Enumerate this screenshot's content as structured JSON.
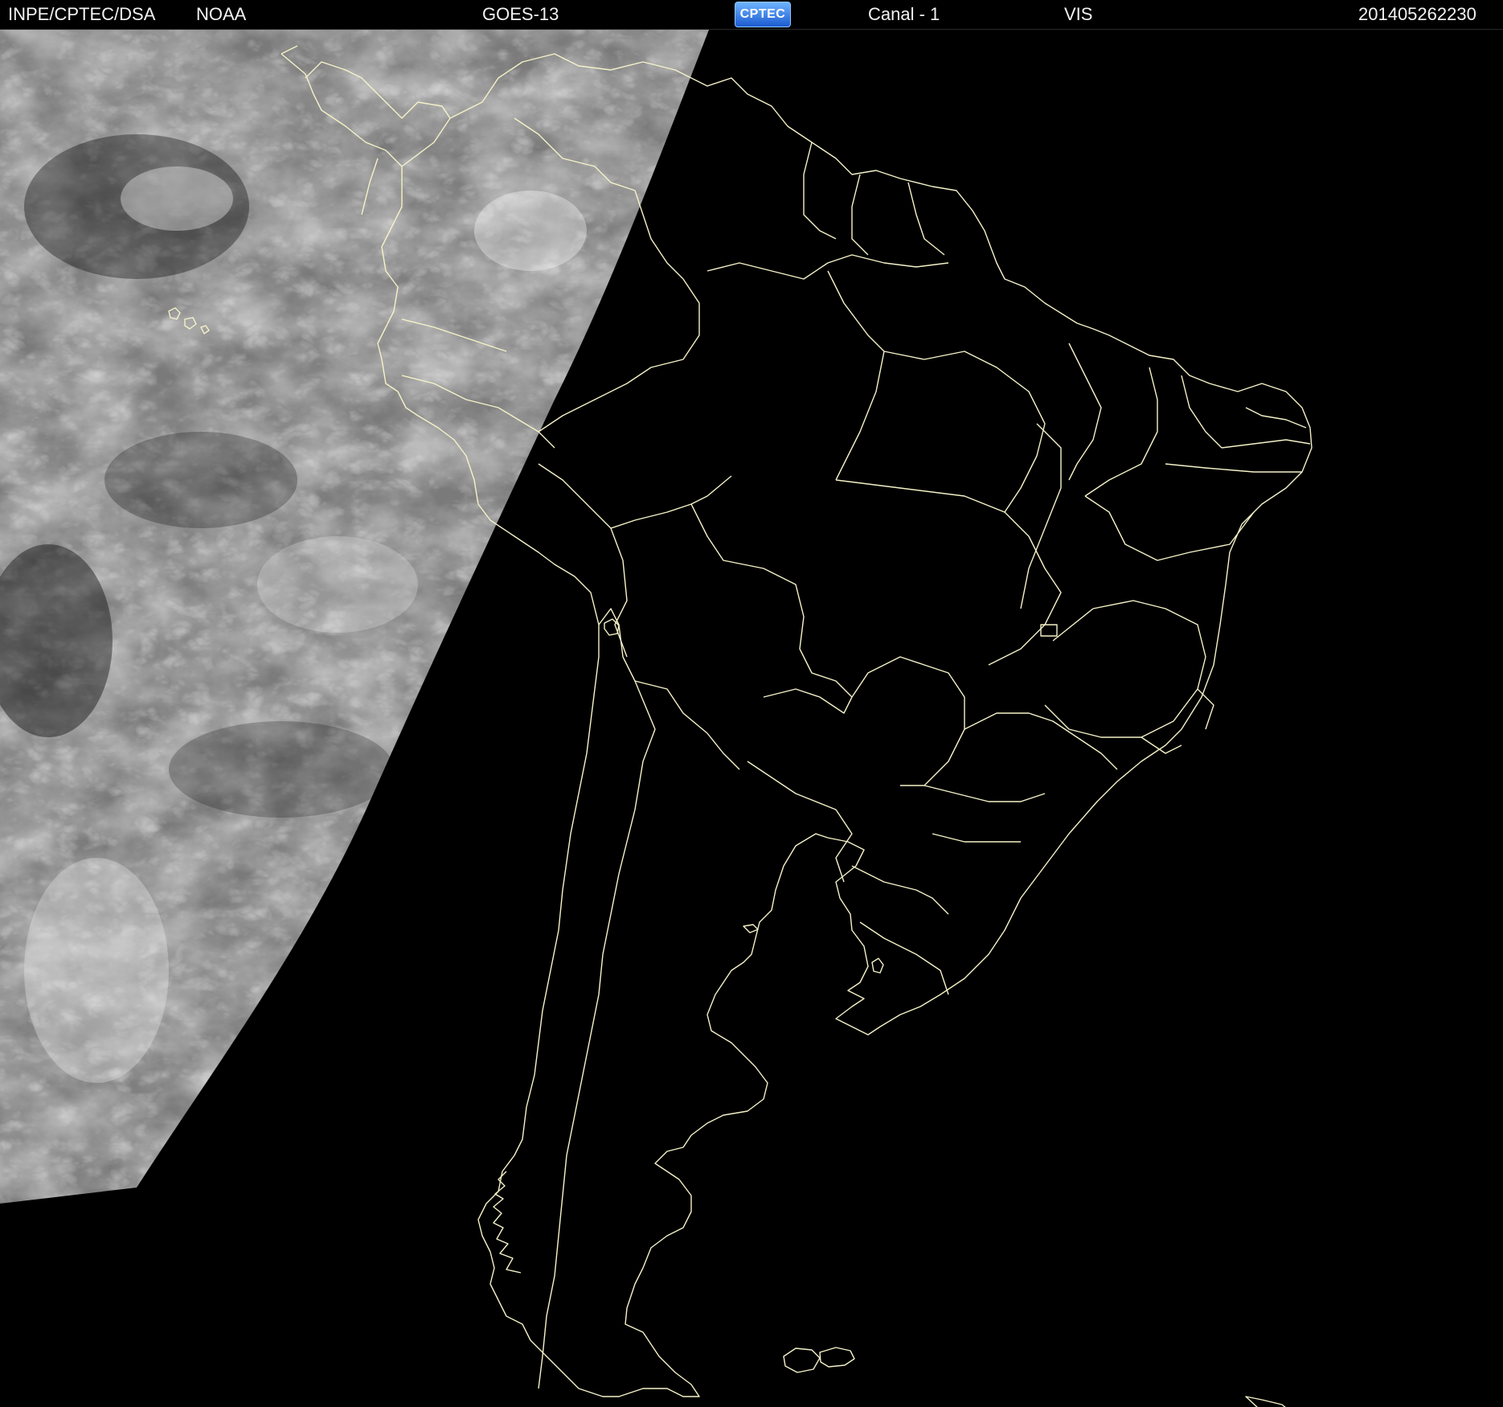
{
  "header": {
    "institute": "INPE/CPTEC/DSA",
    "agency": "NOAA",
    "satellite": "GOES-13",
    "logo_text": "CPTEC",
    "channel": "Canal - 1",
    "band": "VIS",
    "timestamp": "201405262230"
  },
  "map": {
    "region": "South America",
    "boundary_color": "#f5f2c8",
    "background_color": "#000000",
    "daylight_cloud_tone": "#8a8a8a",
    "icons": [
      "cptec-logo-icon"
    ]
  }
}
